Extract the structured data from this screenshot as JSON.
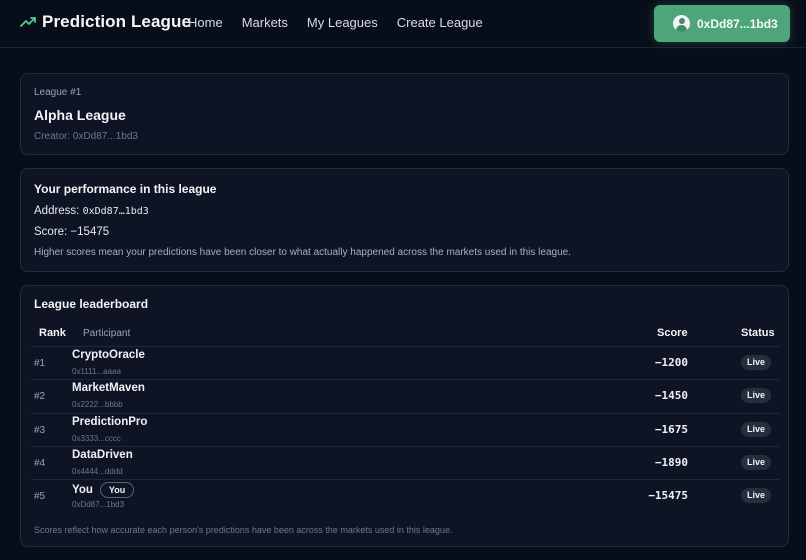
{
  "header": {
    "brand": "Prediction League",
    "nav": [
      "Home",
      "Markets",
      "My Leagues",
      "Create League"
    ],
    "wallet": "0xDd87...1bd3",
    "accent_color": "#4fa57a"
  },
  "league": {
    "number_label": "League #1",
    "name": "Alpha League",
    "creator": "Creator: 0xDd87...1bd3"
  },
  "performance": {
    "title": "Your performance in this league",
    "address_label": "Address:",
    "address_value": "0xDd87…1bd3",
    "score": "Score: −15475",
    "note": "Higher scores mean your predictions have been closer to what actually happened across the markets used in this league."
  },
  "leaderboard": {
    "title": "League leaderboard",
    "columns": {
      "rank": "Rank",
      "participant": "Participant",
      "score": "Score",
      "status": "Status"
    },
    "rows": [
      {
        "rank": "#1",
        "name": "CryptoOracle",
        "address": "0x1111...aaaa",
        "score": "−1200",
        "status": "Live",
        "you_badge": ""
      },
      {
        "rank": "#2",
        "name": "MarketMaven",
        "address": "0x2222...bbbb",
        "score": "−1450",
        "status": "Live",
        "you_badge": ""
      },
      {
        "rank": "#3",
        "name": "PredictionPro",
        "address": "0x3333...cccc",
        "score": "−1675",
        "status": "Live",
        "you_badge": ""
      },
      {
        "rank": "#4",
        "name": "DataDriven",
        "address": "0x4444...dddd",
        "score": "−1890",
        "status": "Live",
        "you_badge": ""
      },
      {
        "rank": "#5",
        "name": "You",
        "address": "0xDd87...1bd3",
        "score": "−15475",
        "status": "Live",
        "you_badge": "You"
      }
    ],
    "footer": "Scores reflect how accurate each person's predictions have been across the markets used in this league."
  }
}
